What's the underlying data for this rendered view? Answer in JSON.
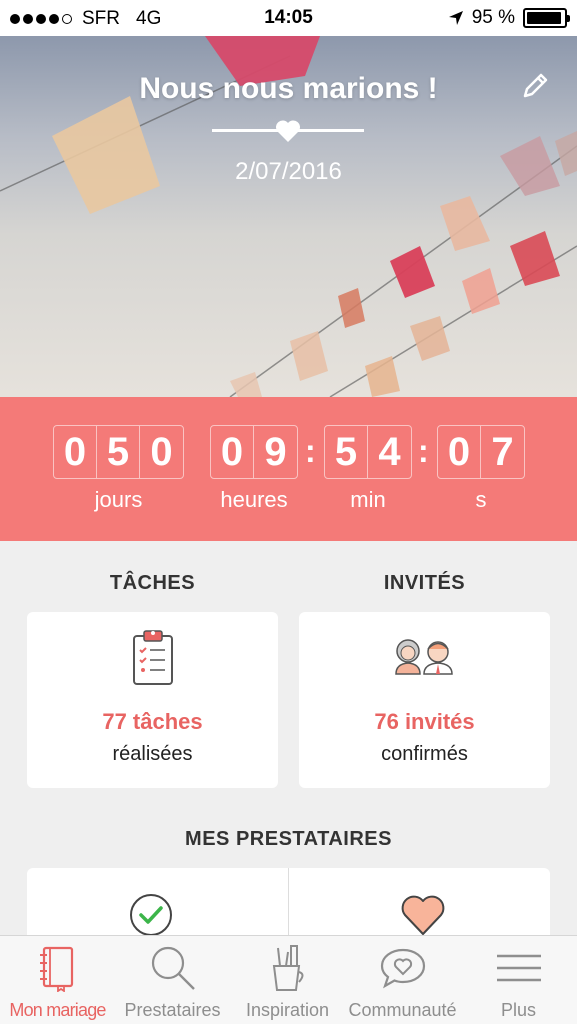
{
  "status_bar": {
    "carrier": "SFR",
    "network": "4G",
    "time": "14:05",
    "battery": "95 %",
    "battery_level": 0.95
  },
  "hero": {
    "title": "Nous nous marions !",
    "date": "2/07/2016",
    "edit_icon": "pencil-icon"
  },
  "countdown": {
    "days": [
      "0",
      "5",
      "0"
    ],
    "hours": [
      "0",
      "9"
    ],
    "minutes": [
      "5",
      "4"
    ],
    "seconds": [
      "0",
      "7"
    ],
    "labels": {
      "days": "jours",
      "hours": "heures",
      "minutes": "min",
      "seconds": "s"
    }
  },
  "summary": {
    "tasks": {
      "title": "TÂCHES",
      "value": "77 tâches",
      "sub": "réalisées",
      "icon": "clipboard-icon"
    },
    "guests": {
      "title": "INVITÉS",
      "value": "76 invités",
      "sub": "confirmés",
      "icon": "couple-icon"
    }
  },
  "providers": {
    "title": "MES PRESTATAIRES",
    "icons": [
      "check-circle-icon",
      "heart-icon"
    ]
  },
  "tab_bar": {
    "tabs": [
      {
        "label": "Mon mariage",
        "icon": "notebook-icon",
        "active": true
      },
      {
        "label": "Prestataires",
        "icon": "search-icon",
        "active": false
      },
      {
        "label": "Inspiration",
        "icon": "pencil-cup-icon",
        "active": false
      },
      {
        "label": "Communauté",
        "icon": "chat-heart-icon",
        "active": false
      },
      {
        "label": "Plus",
        "icon": "menu-icon",
        "active": false
      }
    ]
  },
  "colors": {
    "accent": "#f47a78",
    "accent_text": "#e86462",
    "background": "#efefef"
  }
}
